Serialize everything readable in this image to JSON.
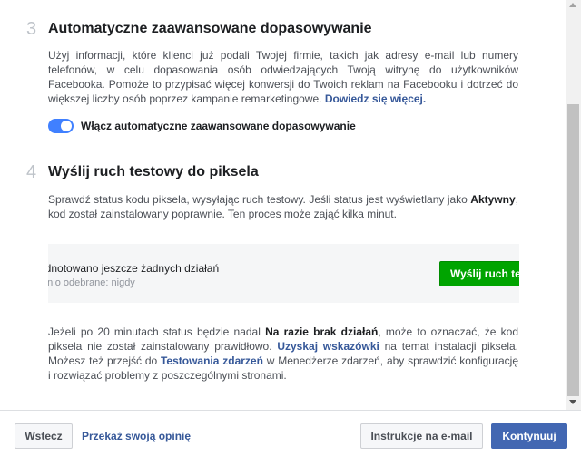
{
  "step3": {
    "number": "3",
    "title": "Automatyczne zaawansowane dopasowywanie",
    "description": "Użyj informacji, które klienci już podali Twojej firmie, takich jak adresy e-mail lub numery telefonów, w celu dopasowania osób odwiedzających Twoją witrynę do użytkowników Facebooka. Pomoże to przypisać więcej konwersji do Twoich reklam na Facebooku i dotrzeć do większej liczby osób poprzez kampanie remarketingowe.",
    "learn_more": "Dowiedz się więcej.",
    "toggle_label": "Włącz automatyczne zaawansowane dopasowywanie",
    "toggle_on": true
  },
  "step4": {
    "number": "4",
    "title": "Wyślij ruch testowy do piksela",
    "desc_part1": "Sprawdź status kodu piksela, wysyłając ruch testowy. Jeśli status jest wyświetlany jako ",
    "desc_status": "Aktywny",
    "desc_part2": ", kod został zainstalowany poprawnie. Ten proces może zająć kilka minut.",
    "status_main": "odnotowano jeszcze żadnych działań",
    "status_sub": "atnio odebrane: nigdy",
    "send_button": "Wyślij ruch te",
    "note_part1": "Jeżeli po 20 minutach status będzie nadal ",
    "note_status": "Na razie brak działań",
    "note_part2": ", może to oznaczać, że kod piksela nie został zainstalowany prawidłowo. ",
    "note_link1": "Uzyskaj wskazówki",
    "note_part3": " na temat instalacji piksela. Możesz też przejść do ",
    "note_link2": "Testowania zdarzeń",
    "note_part4": " w Menedżerze zdarzeń, aby sprawdzić konfigurację i rozwiązać problemy z poszczególnymi stronami."
  },
  "footer": {
    "back_button": "Wstecz",
    "feedback_link": "Przekaż swoją opinię",
    "email_button": "Instrukcje na e-mail",
    "continue_button": "Kontynuuj"
  },
  "colors": {
    "primary": "#4267b2",
    "link": "#365899",
    "toggle": "#4080ff",
    "green": "#00a400"
  }
}
